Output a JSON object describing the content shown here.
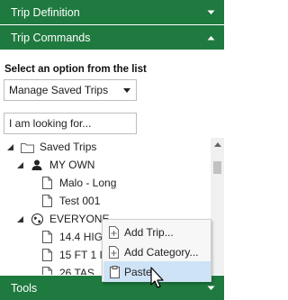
{
  "headers": {
    "trip_definition": "Trip Definition",
    "trip_commands": "Trip Commands",
    "tools": "Tools"
  },
  "prompt": "Select an option from the list",
  "select": {
    "value": "Manage Saved Trips"
  },
  "search": {
    "value": "I am looking for..."
  },
  "tree": {
    "root": "Saved Trips",
    "my_own": "MY OWN",
    "my_own_items": [
      "Malo - Long",
      "Test 001"
    ],
    "everyone": "EVERYONE",
    "everyone_items": [
      "14.4 HIGH",
      "15 FT 1 IN",
      "26 TAS..."
    ]
  },
  "context_menu": {
    "items": [
      "Add Trip...",
      "Add Category...",
      "Paste"
    ],
    "highlighted": "Paste"
  },
  "colors": {
    "header_bg": "#1f7a3f",
    "header_text": "#ffffff",
    "menu_highlight": "#cfe3f7"
  },
  "icons": [
    "chevron-down-icon",
    "chevron-up-icon",
    "folder-icon",
    "user-icon",
    "globe-icon",
    "document-icon",
    "add-document-icon",
    "paste-icon",
    "mouse-cursor-icon"
  ]
}
